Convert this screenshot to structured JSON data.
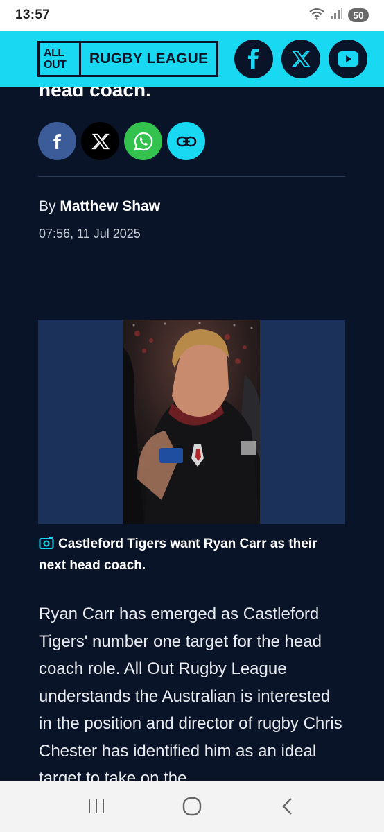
{
  "status_bar": {
    "time": "13:57",
    "battery": "50",
    "icons": [
      "wifi-icon",
      "signal-icon"
    ]
  },
  "header": {
    "logo_top": "ALL",
    "logo_bottom": "OUT",
    "logo_text": "RUGBY LEAGUE",
    "socials": [
      "facebook-icon",
      "x-icon",
      "youtube-icon"
    ],
    "accent_color": "#19d8f2",
    "background_color": "#0a1428"
  },
  "article": {
    "title_tail": "head coach.",
    "share_buttons": [
      "facebook-icon",
      "x-icon",
      "whatsapp-icon",
      "link-icon"
    ],
    "byline_prefix": "By",
    "author": "Matthew Shaw",
    "date": "07:56, 11 Jul 2025",
    "image_caption": "Castleford Tigers want Ryan Carr as their next head coach.",
    "body": "Ryan Carr has emerged as Castleford Tigers' number one target for the head coach role. All Out Rugby League understands the Australian is interested in the position and director of rugby Chris Chester has identified him as an ideal target to take on the"
  },
  "nav_bar": {
    "buttons": [
      "recents-icon",
      "home-icon",
      "back-icon"
    ]
  }
}
